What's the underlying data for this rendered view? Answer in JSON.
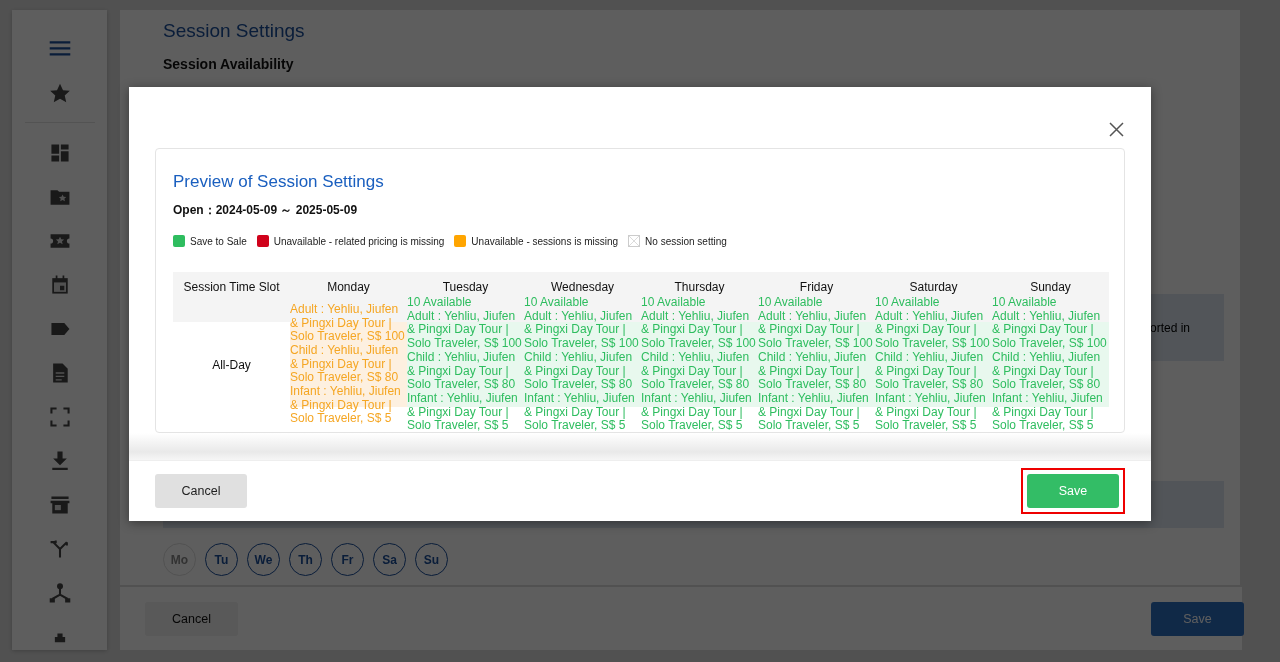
{
  "page": {
    "title": "Session Settings",
    "section": "Session Availability",
    "notice_fragment": "orted in",
    "weekdays": [
      {
        "label": "Mo",
        "disabled": true
      },
      {
        "label": "Tu",
        "disabled": false
      },
      {
        "label": "We",
        "disabled": false
      },
      {
        "label": "Th",
        "disabled": false
      },
      {
        "label": "Fr",
        "disabled": false
      },
      {
        "label": "Sa",
        "disabled": false
      },
      {
        "label": "Su",
        "disabled": false
      }
    ],
    "footer": {
      "cancel": "Cancel",
      "save": "Save"
    }
  },
  "dialog": {
    "title": "Preview of Session Settings",
    "period_label": "Open：",
    "period": "2024-05-09 ～ 2025-05-09",
    "legend": [
      {
        "kind": "swatch",
        "color": "#2ebd5f",
        "label": "Save to Sale"
      },
      {
        "kind": "swatch",
        "color": "#d0021b",
        "label": "Unavailable - related pricing is missing"
      },
      {
        "kind": "swatch",
        "color": "#ffa500",
        "label": "Unavailable - sessions is missing"
      },
      {
        "kind": "empty",
        "label": "No session setting"
      }
    ],
    "table": {
      "columns": [
        "Session Time Slot",
        "Monday",
        "Tuesday",
        "Wednesday",
        "Thursday",
        "Friday",
        "Saturday",
        "Sunday"
      ],
      "rows": [
        {
          "cells": [
            {
              "kind": "slot",
              "text": "All-Day"
            },
            {
              "kind": "sessions_missing",
              "lines": [
                "Adult : Yehliu, Jiufen & Pingxi Day Tour | Solo Traveler, S$ 100",
                "Child : Yehliu, Jiufen & Pingxi Day Tour | Solo Traveler, S$ 80",
                "Infant : Yehliu, Jiufen & Pingxi Day Tour | Solo Traveler, S$ 5"
              ]
            },
            {
              "kind": "on_sale",
              "availability": "10 Available",
              "lines": [
                "Adult : Yehliu, Jiufen & Pingxi Day Tour | Solo Traveler, S$ 100",
                "Child : Yehliu, Jiufen & Pingxi Day Tour | Solo Traveler, S$ 80",
                "Infant : Yehliu, Jiufen & Pingxi Day Tour | Solo Traveler, S$ 5"
              ]
            },
            {
              "kind": "on_sale",
              "availability": "10 Available",
              "lines": [
                "Adult : Yehliu, Jiufen & Pingxi Day Tour | Solo Traveler, S$ 100",
                "Child : Yehliu, Jiufen & Pingxi Day Tour | Solo Traveler, S$ 80",
                "Infant : Yehliu, Jiufen & Pingxi Day Tour | Solo Traveler, S$ 5"
              ]
            },
            {
              "kind": "on_sale",
              "availability": "10 Available",
              "lines": [
                "Adult : Yehliu, Jiufen & Pingxi Day Tour | Solo Traveler, S$ 100",
                "Child : Yehliu, Jiufen & Pingxi Day Tour | Solo Traveler, S$ 80",
                "Infant : Yehliu, Jiufen & Pingxi Day Tour | Solo Traveler, S$ 5"
              ]
            },
            {
              "kind": "on_sale",
              "availability": "10 Available",
              "lines": [
                "Adult : Yehliu, Jiufen & Pingxi Day Tour | Solo Traveler, S$ 100",
                "Child : Yehliu, Jiufen & Pingxi Day Tour | Solo Traveler, S$ 80",
                "Infant : Yehliu, Jiufen & Pingxi Day Tour | Solo Traveler, S$ 5"
              ]
            },
            {
              "kind": "on_sale",
              "availability": "10 Available",
              "lines": [
                "Adult : Yehliu, Jiufen & Pingxi Day Tour | Solo Traveler, S$ 100",
                "Child : Yehliu, Jiufen & Pingxi Day Tour | Solo Traveler, S$ 80",
                "Infant : Yehliu, Jiufen & Pingxi Day Tour | Solo Traveler, S$ 5"
              ]
            },
            {
              "kind": "on_sale",
              "availability": "10 Available",
              "lines": [
                "Adult : Yehliu, Jiufen & Pingxi Day Tour | Solo Traveler, S$ 100",
                "Child : Yehliu, Jiufen & Pingxi Day Tour | Solo Traveler, S$ 80",
                "Infant : Yehliu, Jiufen & Pingxi Day Tour | Solo Traveler, S$ 5"
              ]
            }
          ]
        }
      ]
    },
    "buttons": [
      {
        "kind": "cancel",
        "label": "Cancel",
        "highlighted": false
      },
      {
        "kind": "save",
        "label": "Save",
        "highlighted": true
      }
    ]
  }
}
